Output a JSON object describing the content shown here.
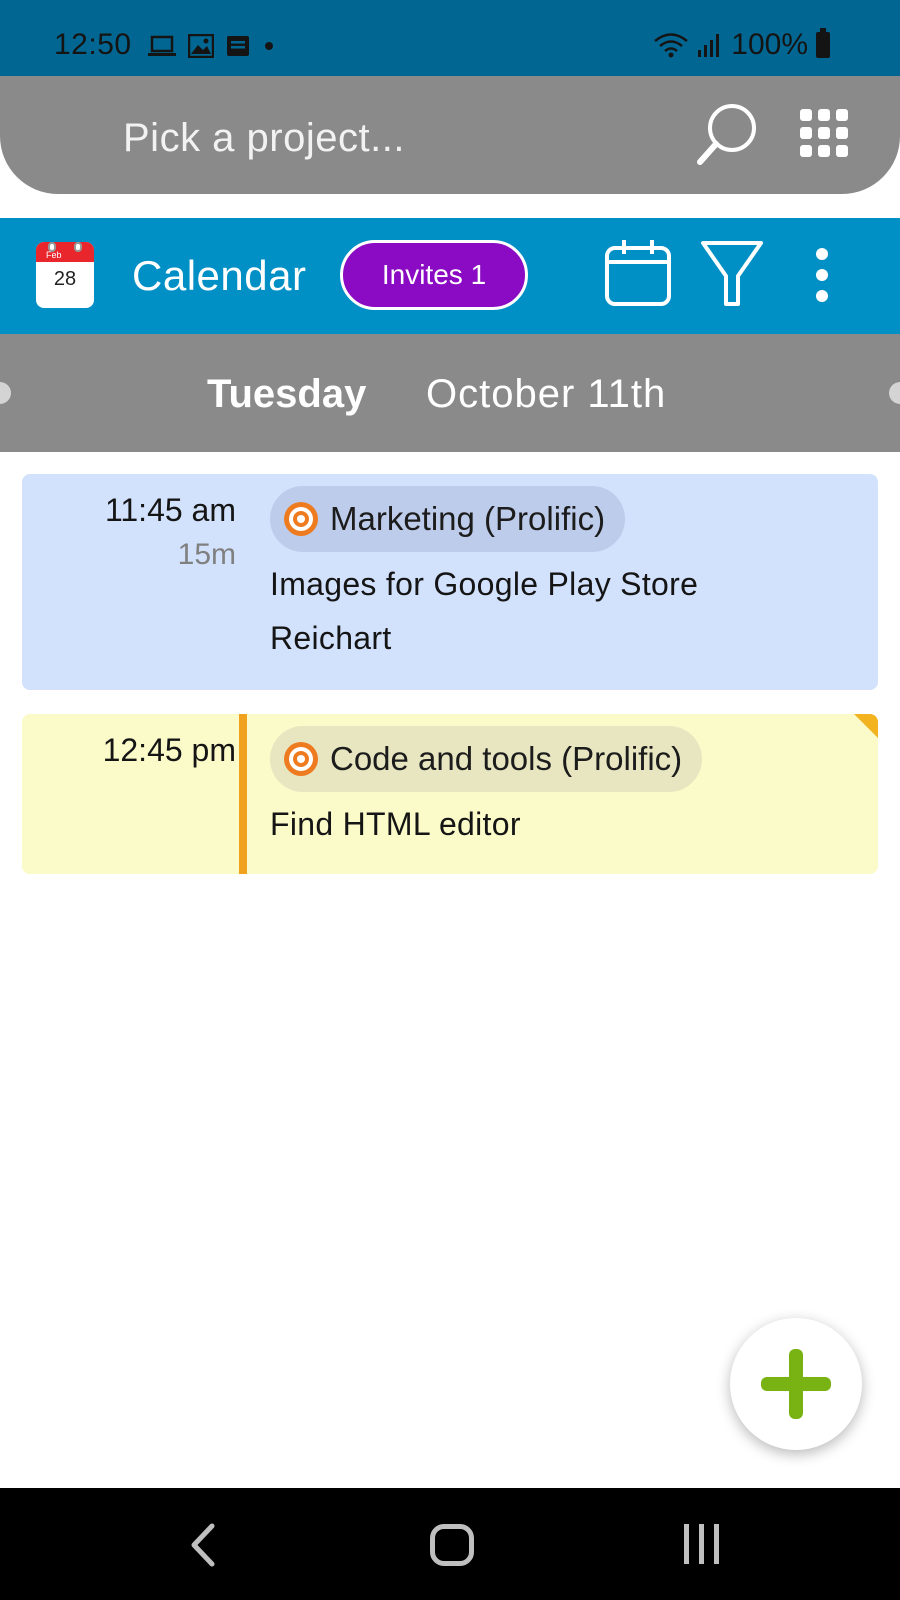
{
  "status_bar": {
    "time": "12:50",
    "battery": "100%",
    "icons": [
      "laptop-icon",
      "image-icon",
      "news-icon",
      "dot-icon",
      "wifi-icon",
      "signal-icon",
      "battery-icon"
    ]
  },
  "project_picker": {
    "placeholder": "Pick a project...",
    "icons": [
      "search-icon",
      "apps-grid-icon"
    ]
  },
  "calendar_header": {
    "app_icon_month": "Feb",
    "app_icon_day": "28",
    "title": "Calendar",
    "invites_label": "Invites 1",
    "icons": [
      "calendar-view-icon",
      "filter-icon",
      "more-vert-icon"
    ],
    "colors": {
      "header_bg": "#0190c6",
      "invites_bg": "#8b0ac3"
    }
  },
  "date_bar": {
    "weekday": "Tuesday",
    "date": "October 11th"
  },
  "events": [
    {
      "time": "11:45 am",
      "duration": "15m",
      "project": "Marketing (Prolific)",
      "lines": [
        "Images for Google Play Store",
        "Reichart"
      ],
      "color": "#d2e1fc"
    },
    {
      "time": "12:45 pm",
      "duration": "",
      "project": "Code and tools (Prolific)",
      "lines": [
        "Find HTML editor"
      ],
      "color": "#fbfac9"
    }
  ],
  "fab": {
    "icon": "plus-icon",
    "color": "#78b313"
  },
  "nav_bar": {
    "icons": [
      "back-icon",
      "home-icon",
      "recents-icon"
    ]
  }
}
